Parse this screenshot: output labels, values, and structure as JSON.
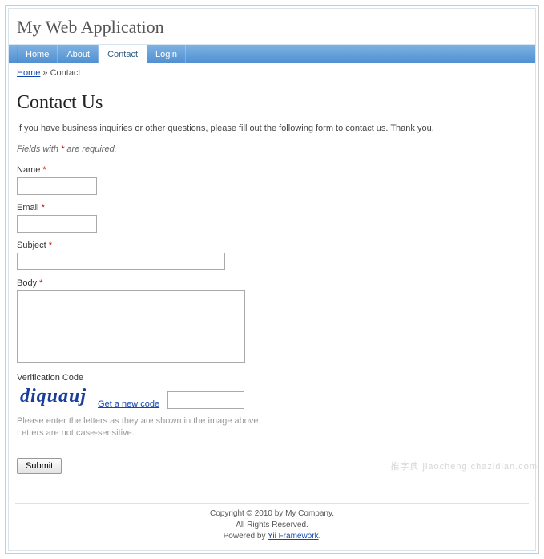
{
  "header": {
    "title": "My Web Application"
  },
  "nav": {
    "items": [
      {
        "label": "Home"
      },
      {
        "label": "About"
      },
      {
        "label": "Contact",
        "active": true
      },
      {
        "label": "Login"
      }
    ]
  },
  "breadcrumb": {
    "home_label": "Home",
    "sep": " » ",
    "current": "Contact"
  },
  "page": {
    "heading": "Contact Us",
    "intro": "If you have business inquiries or other questions, please fill out the following form to contact us. Thank you.",
    "required_note_pre": "Fields with ",
    "required_mark": "*",
    "required_note_post": " are required."
  },
  "form": {
    "name_label": "Name",
    "email_label": "Email",
    "subject_label": "Subject",
    "body_label": "Body",
    "verification_label": "Verification Code",
    "captcha_text": "diquauj",
    "captcha_refresh": "Get a new code",
    "captcha_hint1": "Please enter the letters as they are shown in the image above.",
    "captcha_hint2": "Letters are not case-sensitive.",
    "submit": "Submit"
  },
  "footer": {
    "line1": "Copyright © 2010 by My Company.",
    "line2": "All Rights Reserved.",
    "line3_pre": "Powered by ",
    "line3_link": "Yii Framework",
    "line3_post": "."
  },
  "watermark": "推字典   jiaocheng.chazidian.com"
}
